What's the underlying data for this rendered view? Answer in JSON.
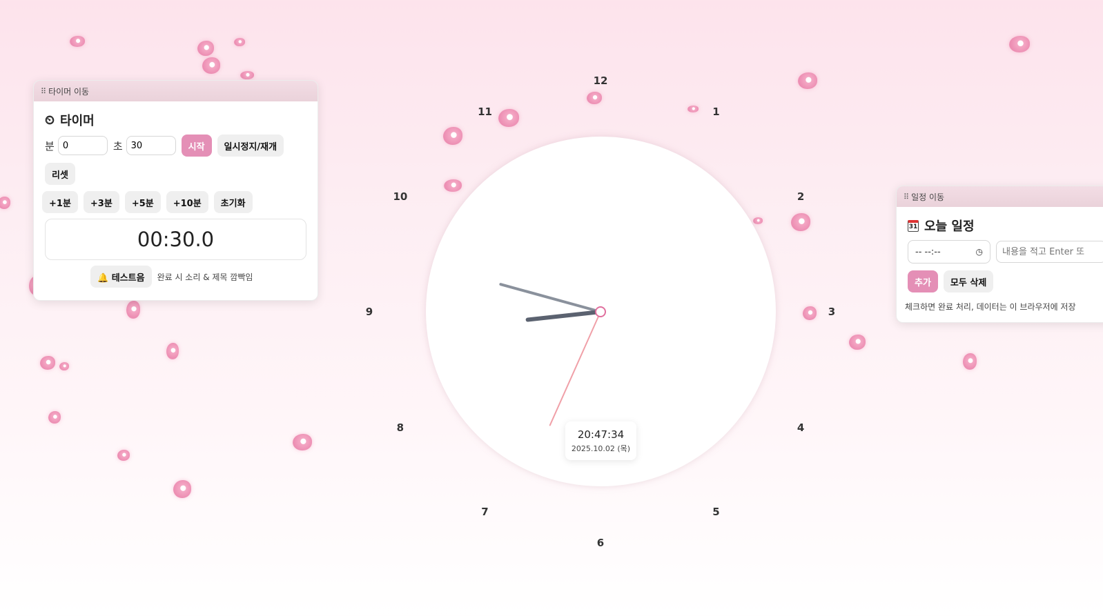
{
  "timer_panel": {
    "drag_label": "타이머 이동",
    "title": "타이머",
    "title_icon": "alarm-clock-icon",
    "minutes_label": "분",
    "minutes_value": "0",
    "seconds_label": "초",
    "seconds_value": "30",
    "start_label": "시작",
    "pause_resume_label": "일시정지/재개",
    "reset_label": "리셋",
    "add_buttons": [
      "+1분",
      "+3분",
      "+5분",
      "+10분"
    ],
    "clear_label": "초기화",
    "display": "00:30.0",
    "test_sound_label": "테스트음",
    "test_sound_icon": "bell-icon",
    "completion_note": "완료 시 소리 & 제목 깜빡임"
  },
  "clock": {
    "numbers": [
      "12",
      "1",
      "2",
      "3",
      "4",
      "5",
      "6",
      "7",
      "8",
      "9",
      "10",
      "11"
    ],
    "time": "20:47:34",
    "date": "2025.10.02 (목)",
    "hand_colors": {
      "hour": "#5b6270",
      "minute": "#8a919c",
      "second": "#f0a0a8",
      "center": "#e06f9d"
    }
  },
  "schedule_panel": {
    "drag_label": "일정 이동",
    "title": "오늘 일정",
    "title_icon": "calendar-icon",
    "time_placeholder": "-- --:--",
    "content_placeholder": "내용을 적고 Enter 또",
    "add_label": "추가",
    "delete_all_label": "모두 삭제",
    "note": "체크하면 완료 처리, 데이터는 이 브라우저에 저장"
  },
  "colors": {
    "accent": "#e48fb6",
    "background": "#fde3ec"
  }
}
